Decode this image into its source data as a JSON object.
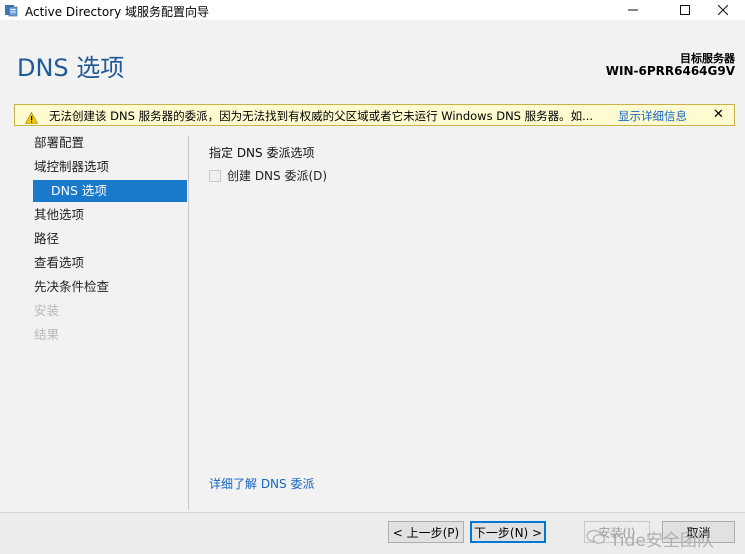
{
  "window": {
    "title": "Active Directory 域服务配置向导"
  },
  "header": {
    "page_title": "DNS 选项",
    "target_label": "目标服务器",
    "target_value": "WIN-6PRR6464G9V"
  },
  "warning": {
    "text": "无法创建该 DNS 服务器的委派，因为无法找到有权威的父区域或者它未运行 Windows DNS 服务器。如...",
    "link": "显示详细信息",
    "close": "✕"
  },
  "nav": {
    "items": [
      {
        "label": "部署配置",
        "state": "normal"
      },
      {
        "label": "域控制器选项",
        "state": "normal"
      },
      {
        "label": "DNS 选项",
        "state": "selected"
      },
      {
        "label": "其他选项",
        "state": "normal"
      },
      {
        "label": "路径",
        "state": "normal"
      },
      {
        "label": "查看选项",
        "state": "normal"
      },
      {
        "label": "先决条件检查",
        "state": "normal"
      },
      {
        "label": "安装",
        "state": "disabled"
      },
      {
        "label": "结果",
        "state": "disabled"
      }
    ]
  },
  "content": {
    "heading": "指定 DNS 委派选项",
    "checkbox_label": "创建 DNS 委派(D)",
    "checkbox_checked": false,
    "learn_more": "详细了解 DNS 委派"
  },
  "footer": {
    "prev": "< 上一步(P)",
    "next": "下一步(N) >",
    "install": "安装(I)",
    "cancel": "取消"
  },
  "watermark": {
    "text": "Tide安全团队"
  },
  "colors": {
    "accent": "#1979ca",
    "title": "#1e5a96",
    "link": "#1565c0",
    "warning_bg": "#fefbd0"
  }
}
